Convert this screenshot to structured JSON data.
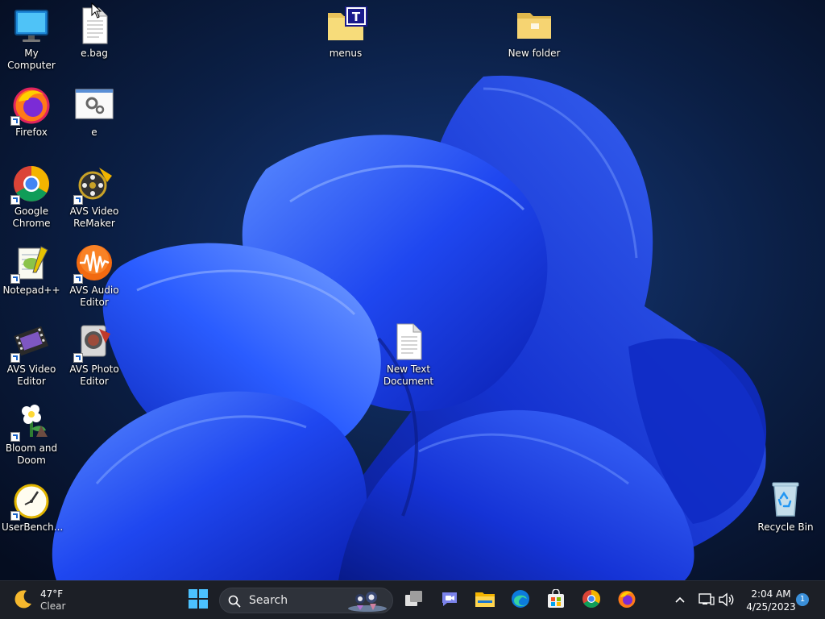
{
  "desktop": {
    "icons": [
      {
        "label": "My Computer",
        "icon": "monitor-icon"
      },
      {
        "label": "e.bag",
        "icon": "document-icon"
      },
      {
        "label": "menus",
        "icon": "folder-icon"
      },
      {
        "label": "New folder",
        "icon": "folder-icon"
      },
      {
        "label": "Firefox",
        "icon": "firefox-icon"
      },
      {
        "label": "e",
        "icon": "settings-file-icon"
      },
      {
        "label": "Google Chrome",
        "icon": "chrome-icon"
      },
      {
        "label": "AVS Video ReMaker",
        "icon": "film-reel-icon"
      },
      {
        "label": "Notepad++",
        "icon": "notepad-icon"
      },
      {
        "label": "AVS Audio Editor",
        "icon": "audio-wave-icon"
      },
      {
        "label": "AVS Video Editor",
        "icon": "film-strip-icon"
      },
      {
        "label": "AVS Photo Editor",
        "icon": "photo-editor-icon"
      },
      {
        "label": "New Text Document",
        "icon": "text-document-icon"
      },
      {
        "label": "Bloom and Doom",
        "icon": "flower-icon"
      },
      {
        "label": "UserBench...",
        "icon": "stopwatch-icon"
      },
      {
        "label": "Recycle Bin",
        "icon": "recycle-bin-icon"
      }
    ]
  },
  "taskbar": {
    "weather": {
      "temp": "47°F",
      "condition": "Clear"
    },
    "search": {
      "label": "Search"
    },
    "apps": [
      "start-icon",
      "task-view-icon",
      "chat-icon",
      "file-explorer-icon",
      "edge-icon",
      "store-icon",
      "chrome-icon",
      "firefox-icon"
    ],
    "clock": {
      "time": "2:04 AM",
      "date": "4/25/2023"
    },
    "notification_count": "1"
  },
  "colors": {
    "taskbar_bg": "#1c1f26",
    "wallpaper_dark": "#07132b",
    "bloom_blue": "#1e4fff"
  }
}
